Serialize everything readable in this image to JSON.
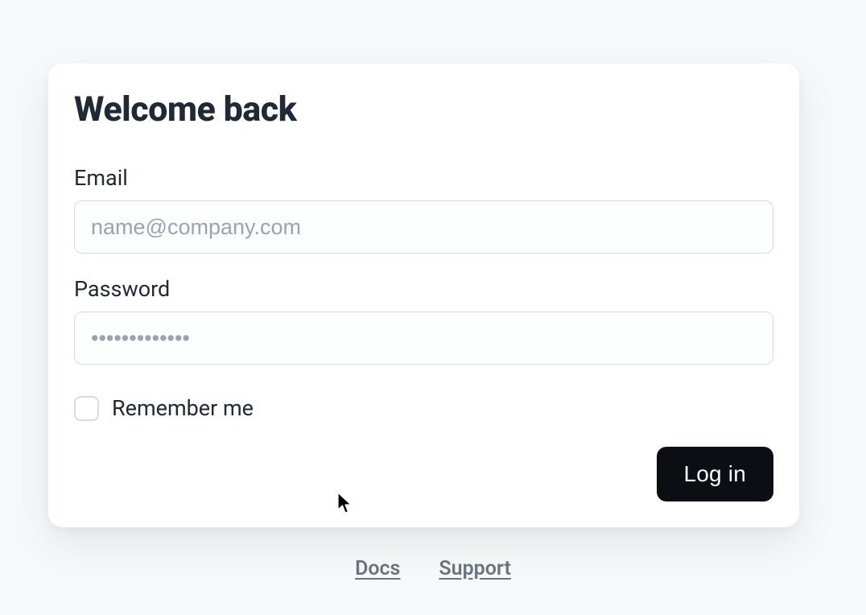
{
  "heading": "Welcome back",
  "email": {
    "label": "Email",
    "placeholder": "name@company.com",
    "value": ""
  },
  "password": {
    "label": "Password",
    "placeholder": "•••••••••••••",
    "value": ""
  },
  "remember": {
    "label": "Remember me",
    "checked": false
  },
  "login_button": "Log in",
  "footer": {
    "docs": "Docs",
    "support": "Support"
  }
}
